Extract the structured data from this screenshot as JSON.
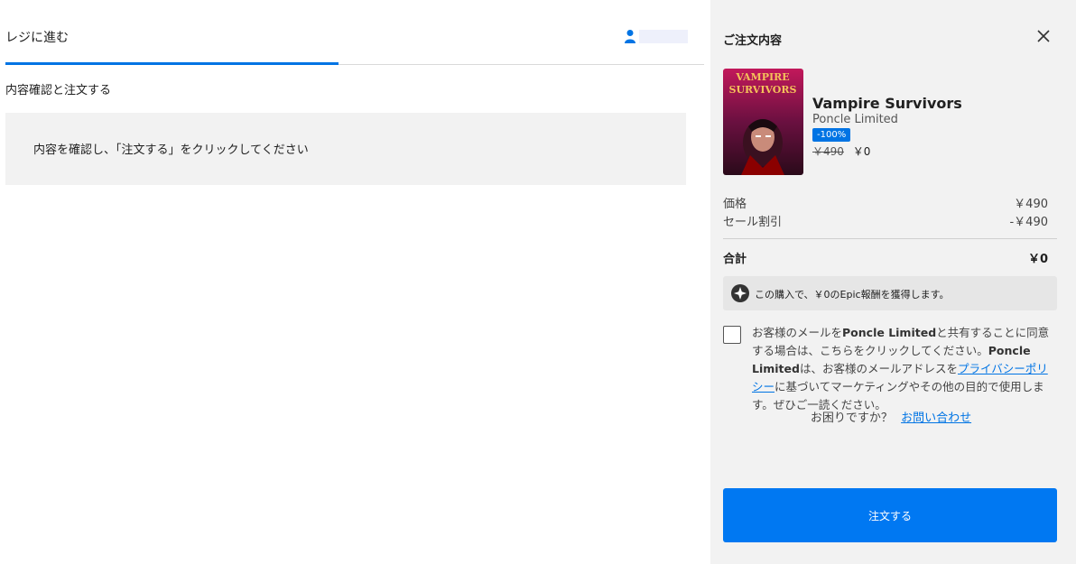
{
  "left": {
    "tab_label": "レジに進む",
    "section_title": "内容確認と注文する",
    "confirm_message": "内容を確認し、「注文する」をクリックしてください"
  },
  "summary": {
    "title": "ご注文内容",
    "product": {
      "image_text_line1": "VAMPIRE",
      "image_text_line2": "SURVIVORS",
      "name": "Vampire Survivors",
      "publisher": "Poncle Limited",
      "discount": "-100%",
      "original_price": "￥490",
      "current_price": "￥0"
    },
    "price_label": "価格",
    "price_value": "￥490",
    "sale_label": "セール割引",
    "sale_value": "-￥490",
    "total_label": "合計",
    "total_value": "￥0",
    "reward_text": "この購入で、￥0のEpic報酬を獲得します。",
    "consent": {
      "part1": "お客様のメールを",
      "publisher1": "Poncle Limited",
      "part2": "と共有することに同意する場合は、こちらをクリックしてください。",
      "publisher2": "Poncle Limited",
      "part3": "は、お客様のメールアドレスを",
      "privacy_link": "プライバシーポリシー",
      "part4": "に基づいてマーケティングやその他の目的で使用します。ぜひご一読ください。"
    },
    "help_text": "お困りですか？",
    "help_link": "お問い合わせ",
    "order_button": "注文する"
  },
  "colors": {
    "accent": "#0074e4",
    "button": "#0078f2",
    "panel_bg": "#f2f2f2"
  }
}
